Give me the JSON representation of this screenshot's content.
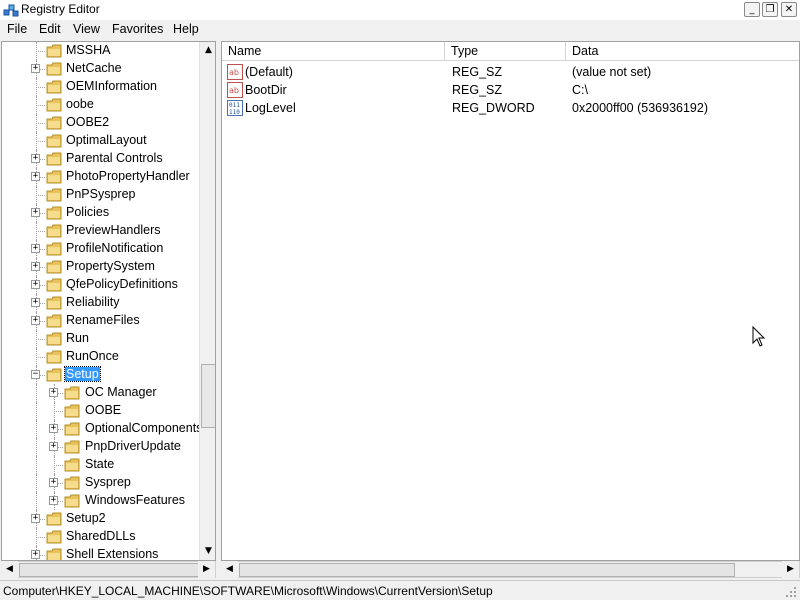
{
  "window": {
    "title": "Registry Editor",
    "min_glyph": "_",
    "max_glyph": "❐",
    "close_glyph": "✕"
  },
  "menu": [
    "File",
    "Edit",
    "View",
    "Favorites",
    "Help"
  ],
  "tree": {
    "items": [
      {
        "label": "MSSHA",
        "expander": "",
        "selected": false
      },
      {
        "label": "NetCache",
        "expander": "+",
        "selected": false
      },
      {
        "label": "OEMInformation",
        "expander": "",
        "selected": false
      },
      {
        "label": "oobe",
        "expander": "",
        "selected": false
      },
      {
        "label": "OOBE2",
        "expander": "",
        "selected": false
      },
      {
        "label": "OptimalLayout",
        "expander": "",
        "selected": false
      },
      {
        "label": "Parental Controls",
        "expander": "+",
        "selected": false
      },
      {
        "label": "PhotoPropertyHandler",
        "expander": "+",
        "selected": false
      },
      {
        "label": "PnPSysprep",
        "expander": "",
        "selected": false
      },
      {
        "label": "Policies",
        "expander": "+",
        "selected": false
      },
      {
        "label": "PreviewHandlers",
        "expander": "",
        "selected": false
      },
      {
        "label": "ProfileNotification",
        "expander": "+",
        "selected": false
      },
      {
        "label": "PropertySystem",
        "expander": "+",
        "selected": false
      },
      {
        "label": "QfePolicyDefinitions",
        "expander": "+",
        "selected": false
      },
      {
        "label": "Reliability",
        "expander": "+",
        "selected": false
      },
      {
        "label": "RenameFiles",
        "expander": "+",
        "selected": false
      },
      {
        "label": "Run",
        "expander": "",
        "selected": false
      },
      {
        "label": "RunOnce",
        "expander": "",
        "selected": false
      },
      {
        "label": "Setup",
        "expander": "−",
        "selected": true
      },
      {
        "label": "Shell Extensions",
        "expander": "+",
        "selected": false
      }
    ],
    "children": [
      {
        "label": "OC Manager",
        "expander": "+"
      },
      {
        "label": "OOBE",
        "expander": ""
      },
      {
        "label": "OptionalComponents",
        "expander": "+"
      },
      {
        "label": "PnpDriverUpdate",
        "expander": "+"
      },
      {
        "label": "State",
        "expander": ""
      },
      {
        "label": "Sysprep",
        "expander": "+"
      },
      {
        "label": "WindowsFeatures",
        "expander": "+"
      }
    ],
    "after": [
      {
        "label": "Setup2",
        "expander": "+"
      },
      {
        "label": "SharedDLLs",
        "expander": ""
      },
      {
        "label": "Shell Extensions",
        "expander": "+"
      }
    ],
    "scroll_up": "▲",
    "scroll_down": "▼",
    "scroll_left": "◀",
    "scroll_right": "▶"
  },
  "list": {
    "columns": [
      "Name",
      "Type",
      "Data"
    ],
    "rows": [
      {
        "icon": "string-value-icon",
        "name": "(Default)",
        "type": "REG_SZ",
        "data": "(value not set)"
      },
      {
        "icon": "string-value-icon",
        "name": "BootDir",
        "type": "REG_SZ",
        "data": "C:\\"
      },
      {
        "icon": "dword-value-icon",
        "name": "LogLevel",
        "type": "REG_DWORD",
        "data": "0x2000ff00 (536936192)"
      }
    ],
    "scroll_left": "◀",
    "scroll_right": "▶"
  },
  "status": {
    "path": "Computer\\HKEY_LOCAL_MACHINE\\SOFTWARE\\Microsoft\\Windows\\CurrentVersion\\Setup"
  },
  "colors": {
    "selection": "#3399ff",
    "folder": "#e8c25a"
  }
}
